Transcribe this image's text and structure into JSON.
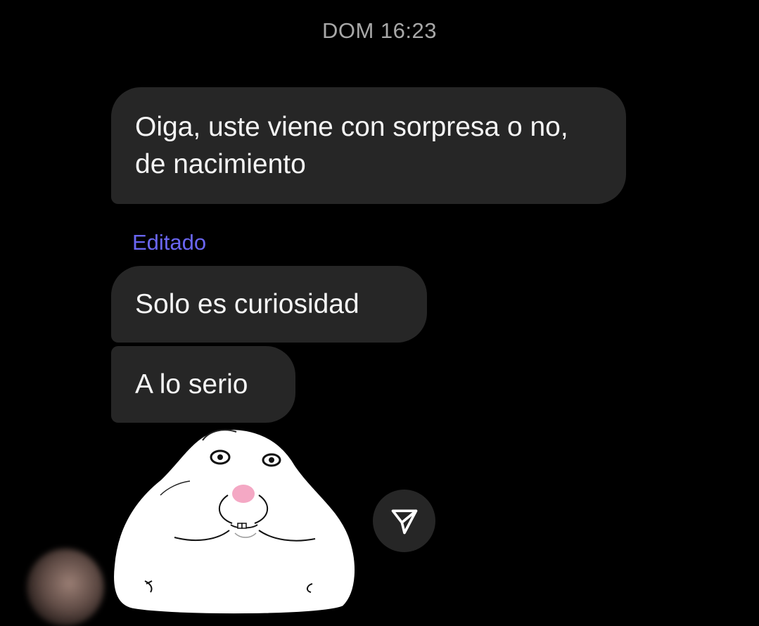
{
  "chat": {
    "timestamp": "DOM 16:23",
    "messages": [
      {
        "text": "Oiga, uste viene con sorpresa o no, de nacimiento"
      },
      {
        "edited_label": "Editado",
        "text": "Solo es curiosidad"
      },
      {
        "text": "A lo serio"
      }
    ],
    "sticker": "hamster-meme-sticker"
  },
  "colors": {
    "background": "#000000",
    "bubble": "#262626",
    "edited_label": "#6a66f2",
    "timestamp": "#a8a8a8"
  },
  "icons": {
    "share": "paper-plane-icon"
  }
}
